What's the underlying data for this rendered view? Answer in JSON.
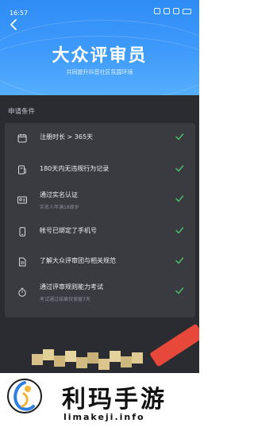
{
  "status_bar": {
    "time": "16:57"
  },
  "hero": {
    "title": "大众评审员",
    "subtitle": "共同提升抖音社区氛围环境"
  },
  "section": {
    "title": "申请条件"
  },
  "conditions": [
    {
      "label": "注册时长 > 365天",
      "sub": "",
      "icon": "calendar-icon",
      "done": true
    },
    {
      "label": "180天内无违规行为记录",
      "sub": "",
      "icon": "record-icon",
      "done": true
    },
    {
      "label": "通过实名认证",
      "sub": "实名人年满18周岁",
      "icon": "id-card-icon",
      "done": true
    },
    {
      "label": "帐号已绑定了手机号",
      "sub": "",
      "icon": "phone-icon",
      "done": true
    },
    {
      "label": "了解大众评审团与相关规范",
      "sub": "",
      "icon": "document-icon",
      "done": true
    },
    {
      "label": "通过评审规则能力考试",
      "sub": "考试通过结果仅保留7天",
      "icon": "stopwatch-icon",
      "done": true
    }
  ],
  "colors": {
    "accent": "#3f9bfb",
    "check": "#4cc36a",
    "background": "#2b2c31"
  },
  "banner": {
    "brand": "利玛手游",
    "url": "limakeji.info"
  }
}
